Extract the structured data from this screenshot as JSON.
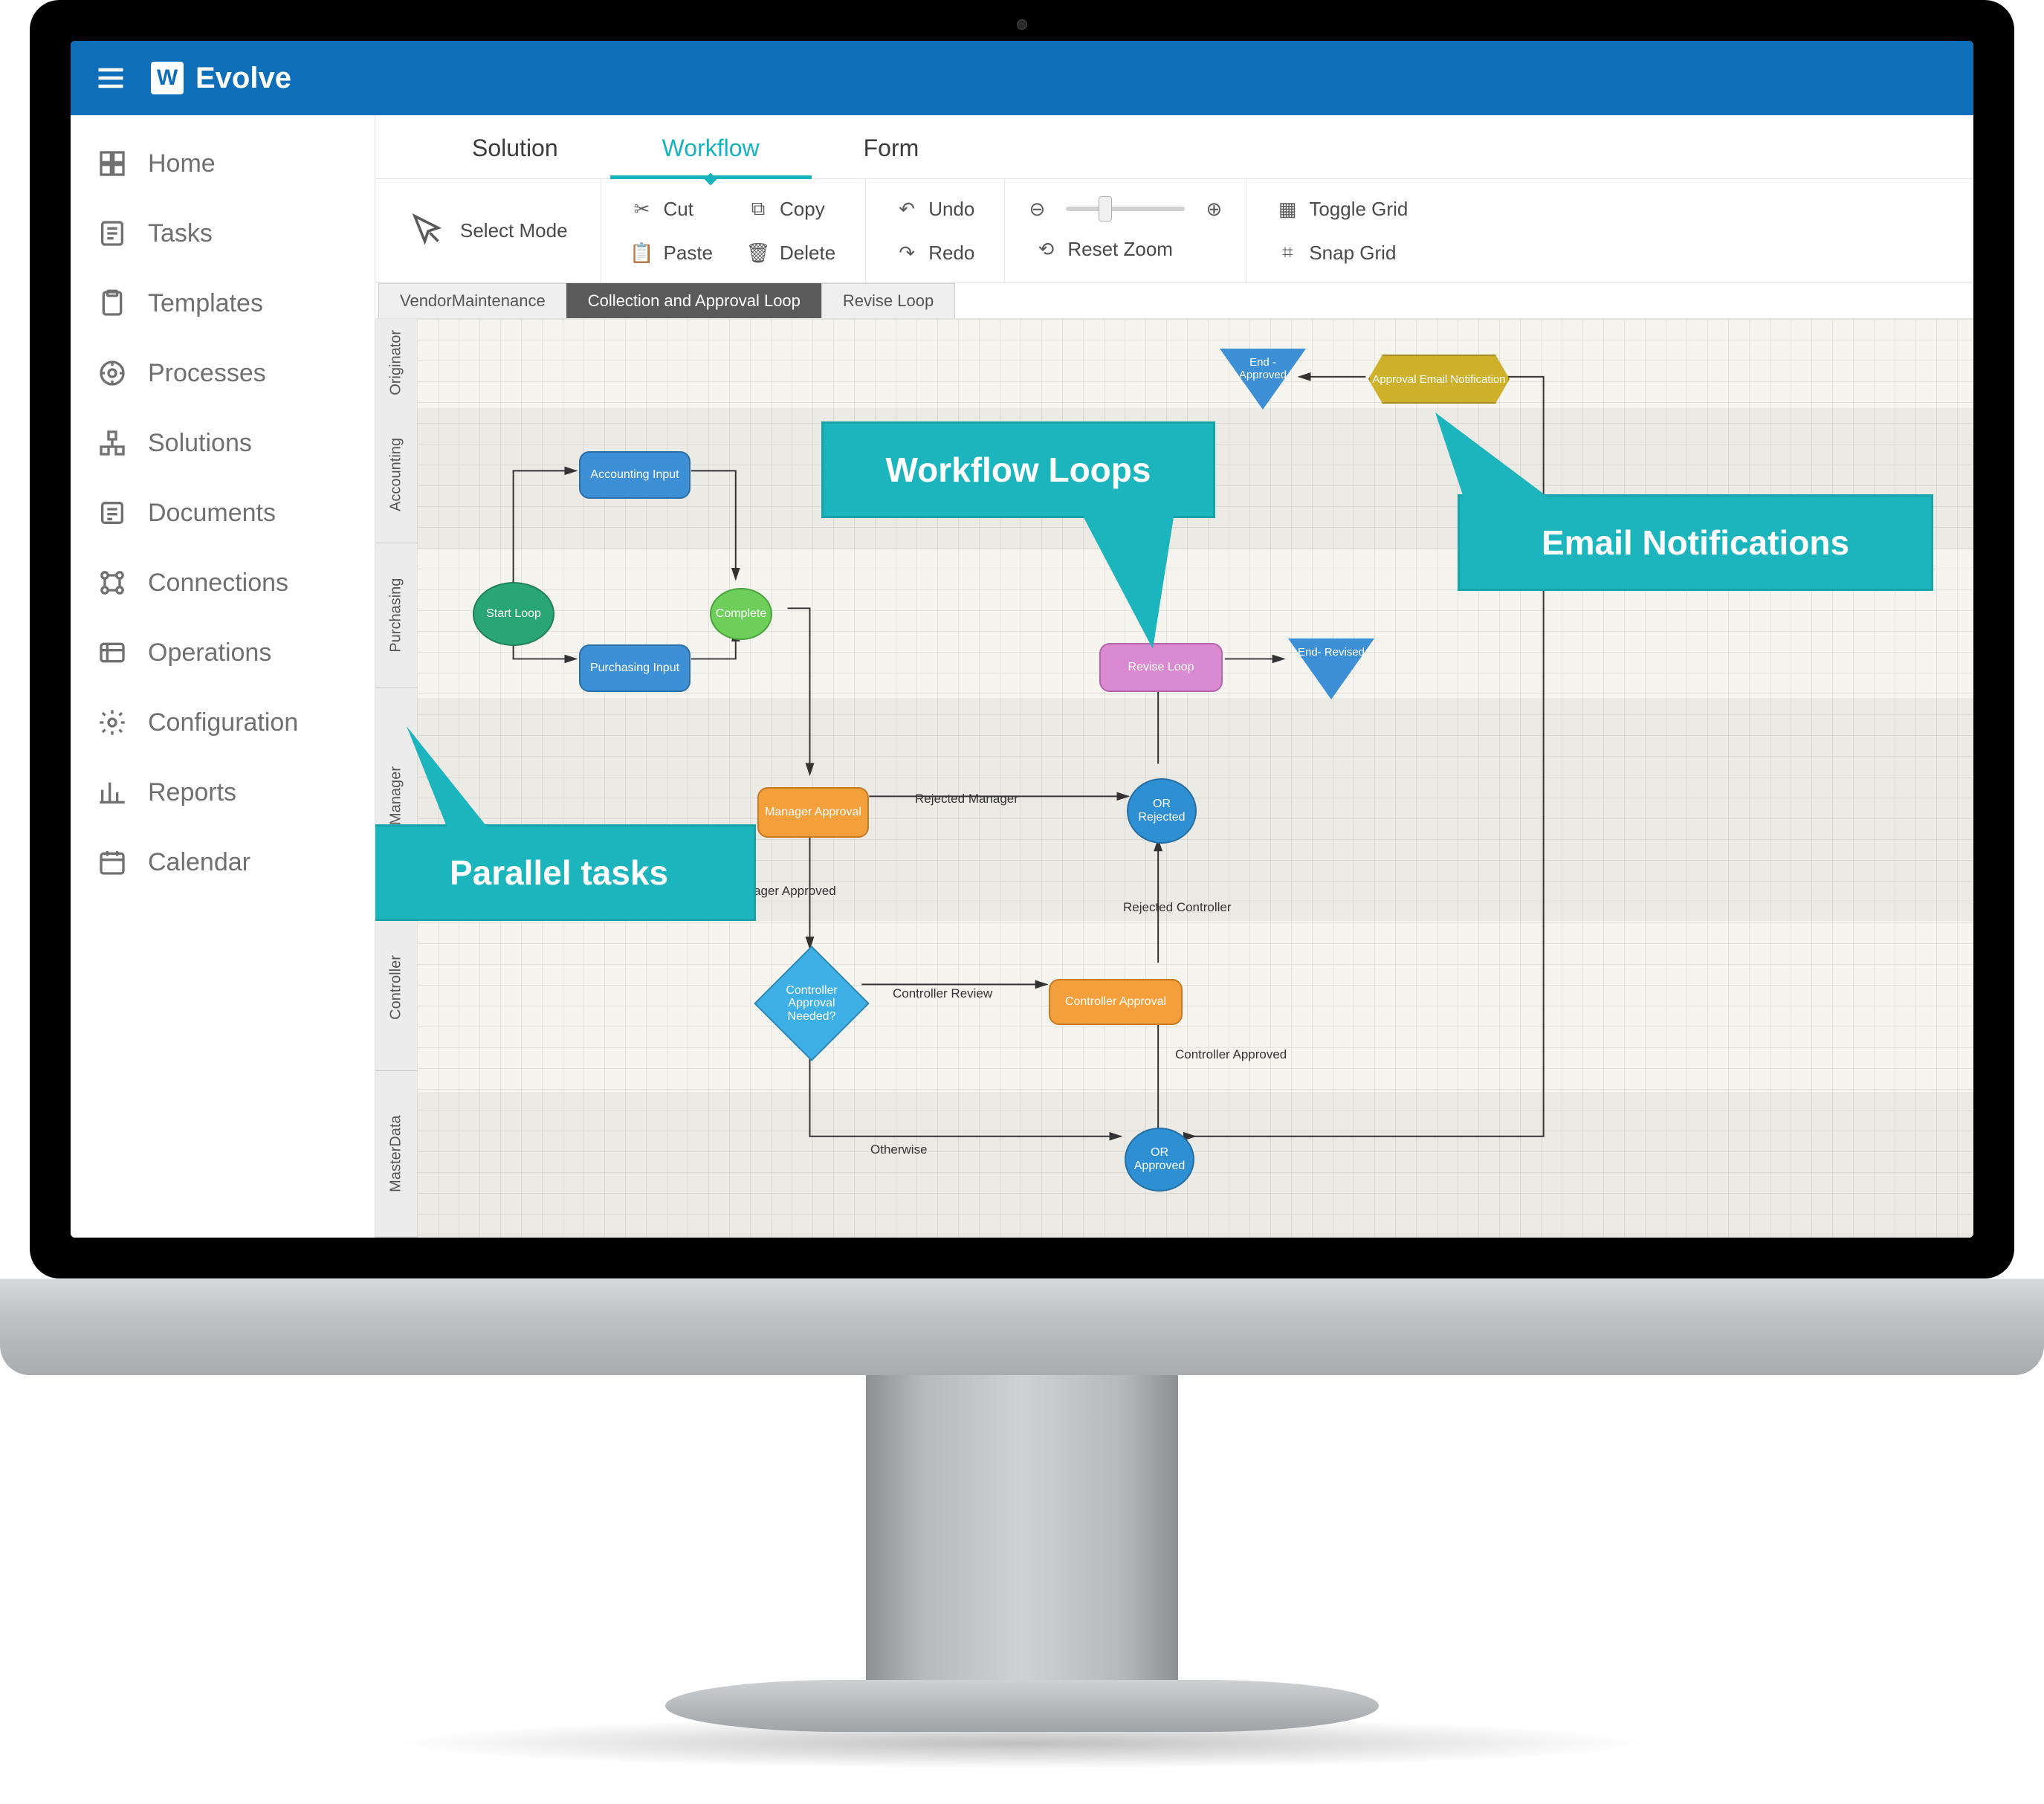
{
  "brand": {
    "logo_letter": "W",
    "title": "Evolve"
  },
  "sidebar": {
    "items": [
      {
        "label": "Home"
      },
      {
        "label": "Tasks"
      },
      {
        "label": "Templates"
      },
      {
        "label": "Processes"
      },
      {
        "label": "Solutions"
      },
      {
        "label": "Documents"
      },
      {
        "label": "Connections"
      },
      {
        "label": "Operations"
      },
      {
        "label": "Configuration"
      },
      {
        "label": "Reports"
      },
      {
        "label": "Calendar"
      }
    ]
  },
  "tabs": {
    "items": [
      {
        "label": "Solution"
      },
      {
        "label": "Workflow"
      },
      {
        "label": "Form"
      }
    ],
    "active_index": 1
  },
  "toolbar": {
    "select_mode": "Select Mode",
    "cut": "Cut",
    "paste": "Paste",
    "copy": "Copy",
    "delete": "Delete",
    "undo": "Undo",
    "redo": "Redo",
    "reset_zoom": "Reset Zoom",
    "toggle_grid": "Toggle Grid",
    "snap_grid": "Snap Grid"
  },
  "secondary_tabs": {
    "items": [
      {
        "label": "VendorMaintenance"
      },
      {
        "label": "Collection and Approval Loop"
      },
      {
        "label": "Revise Loop"
      }
    ],
    "active_index": 1
  },
  "swimlanes": [
    {
      "label": "Originator"
    },
    {
      "label": "Accounting"
    },
    {
      "label": "Purchasing"
    },
    {
      "label": "Manager"
    },
    {
      "label": "Controller"
    },
    {
      "label": "MasterData"
    }
  ],
  "workflow": {
    "nodes": {
      "start_loop": "Start Loop",
      "accounting_input": "Accounting Input",
      "purchasing_input": "Purchasing Input",
      "complete": "Complete",
      "manager_approval": "Manager Approval",
      "controller_needed": "Controller Approval Needed?",
      "controller_approval": "Controller Approval",
      "or_rejected": "OR Rejected",
      "or_approved": "OR Approved",
      "revise_loop": "Revise Loop",
      "end_approved": "End - Approved",
      "end_revised": "End- Revised",
      "approval_email": "Approval Email Notification"
    },
    "edges": {
      "rejected_manager": "Rejected Manager",
      "manager_approved": "Manager Approved",
      "controller_review": "Controller Review",
      "rejected_controller": "Rejected Controller",
      "controller_approved": "Controller Approved",
      "otherwise": "Otherwise"
    }
  },
  "callouts": {
    "parallel_tasks": "Parallel tasks",
    "workflow_loops": "Workflow Loops",
    "email_notifications": "Email Notifications"
  }
}
